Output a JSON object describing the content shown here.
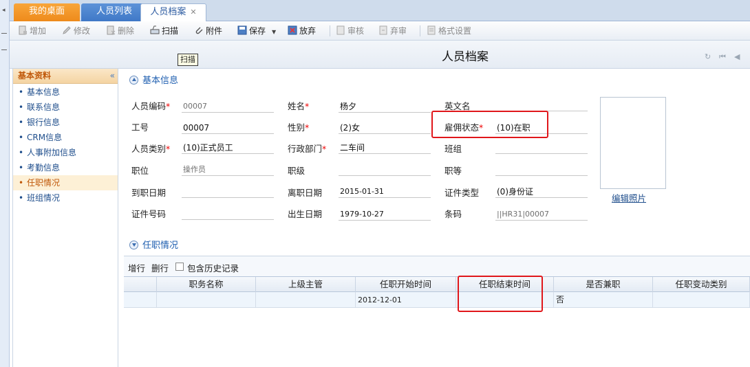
{
  "tabs": [
    {
      "label": "我的桌面"
    },
    {
      "label": "人员列表"
    },
    {
      "label": "人员档案"
    }
  ],
  "toolbar": {
    "add": "增加",
    "edit": "修改",
    "delete": "删除",
    "scan": "扫描",
    "attachment": "附件",
    "save": "保存",
    "discard": "放弃",
    "audit": "审核",
    "unaudit": "弃审",
    "format": "格式设置"
  },
  "tooltip": "扫描",
  "page_title": "人员档案",
  "sidebar": {
    "title": "基本资料",
    "collapse": "«",
    "items": [
      {
        "label": "基本信息"
      },
      {
        "label": "联系信息"
      },
      {
        "label": "银行信息"
      },
      {
        "label": "CRM信息"
      },
      {
        "label": "人事附加信息"
      },
      {
        "label": "考勤信息"
      },
      {
        "label": "任职情况"
      },
      {
        "label": "班组情况"
      }
    ]
  },
  "basic_section": {
    "title": "基本信息"
  },
  "form": {
    "emp_code_label": "人员编码",
    "emp_code": "00007",
    "name_label": "姓名",
    "name": "杨夕",
    "en_name_label": "英文名",
    "en_name": "",
    "work_no_label": "工号",
    "work_no": "00007",
    "gender_label": "性别",
    "gender": "(2)女",
    "emp_status_label": "雇佣状态",
    "emp_status": "(10)在职",
    "emp_type_label": "人员类别",
    "emp_type": "(10)正式员工",
    "dept_label": "行政部门",
    "dept": "二车间",
    "team_label": "班组",
    "team": "",
    "position_label": "职位",
    "position": "操作员",
    "rank_label": "职级",
    "rank": "",
    "grade_label": "职等",
    "grade": "",
    "entry_date_label": "到职日期",
    "entry_date": "",
    "leave_date_label": "离职日期",
    "leave_date": "2015-01-31",
    "id_type_label": "证件类型",
    "id_type": "(0)身份证",
    "id_no_label": "证件号码",
    "id_no": "",
    "birth_label": "出生日期",
    "birth": "1979-10-27",
    "barcode_label": "条码",
    "barcode": "||HR31|00007"
  },
  "photo": {
    "edit_label": "编辑照片"
  },
  "job_section": {
    "title": "任职情况"
  },
  "grid_toolbar": {
    "add_row": "增行",
    "del_row": "删行",
    "history": "包含历史记录"
  },
  "grid": {
    "columns": [
      "职务名称",
      "上级主管",
      "任职开始时间",
      "任职结束时间",
      "是否兼职",
      "任职变动类别"
    ],
    "rows": [
      {
        "title": "",
        "supervisor": "",
        "start": "2012-12-01",
        "end": "",
        "part_time": "否",
        "change_type": ""
      }
    ]
  },
  "colors": {
    "accent_orange": "#ee8a1b",
    "tab_blue": "#3f78c7",
    "highlight_red": "#e0161a",
    "link_blue": "#1f4e8c"
  }
}
